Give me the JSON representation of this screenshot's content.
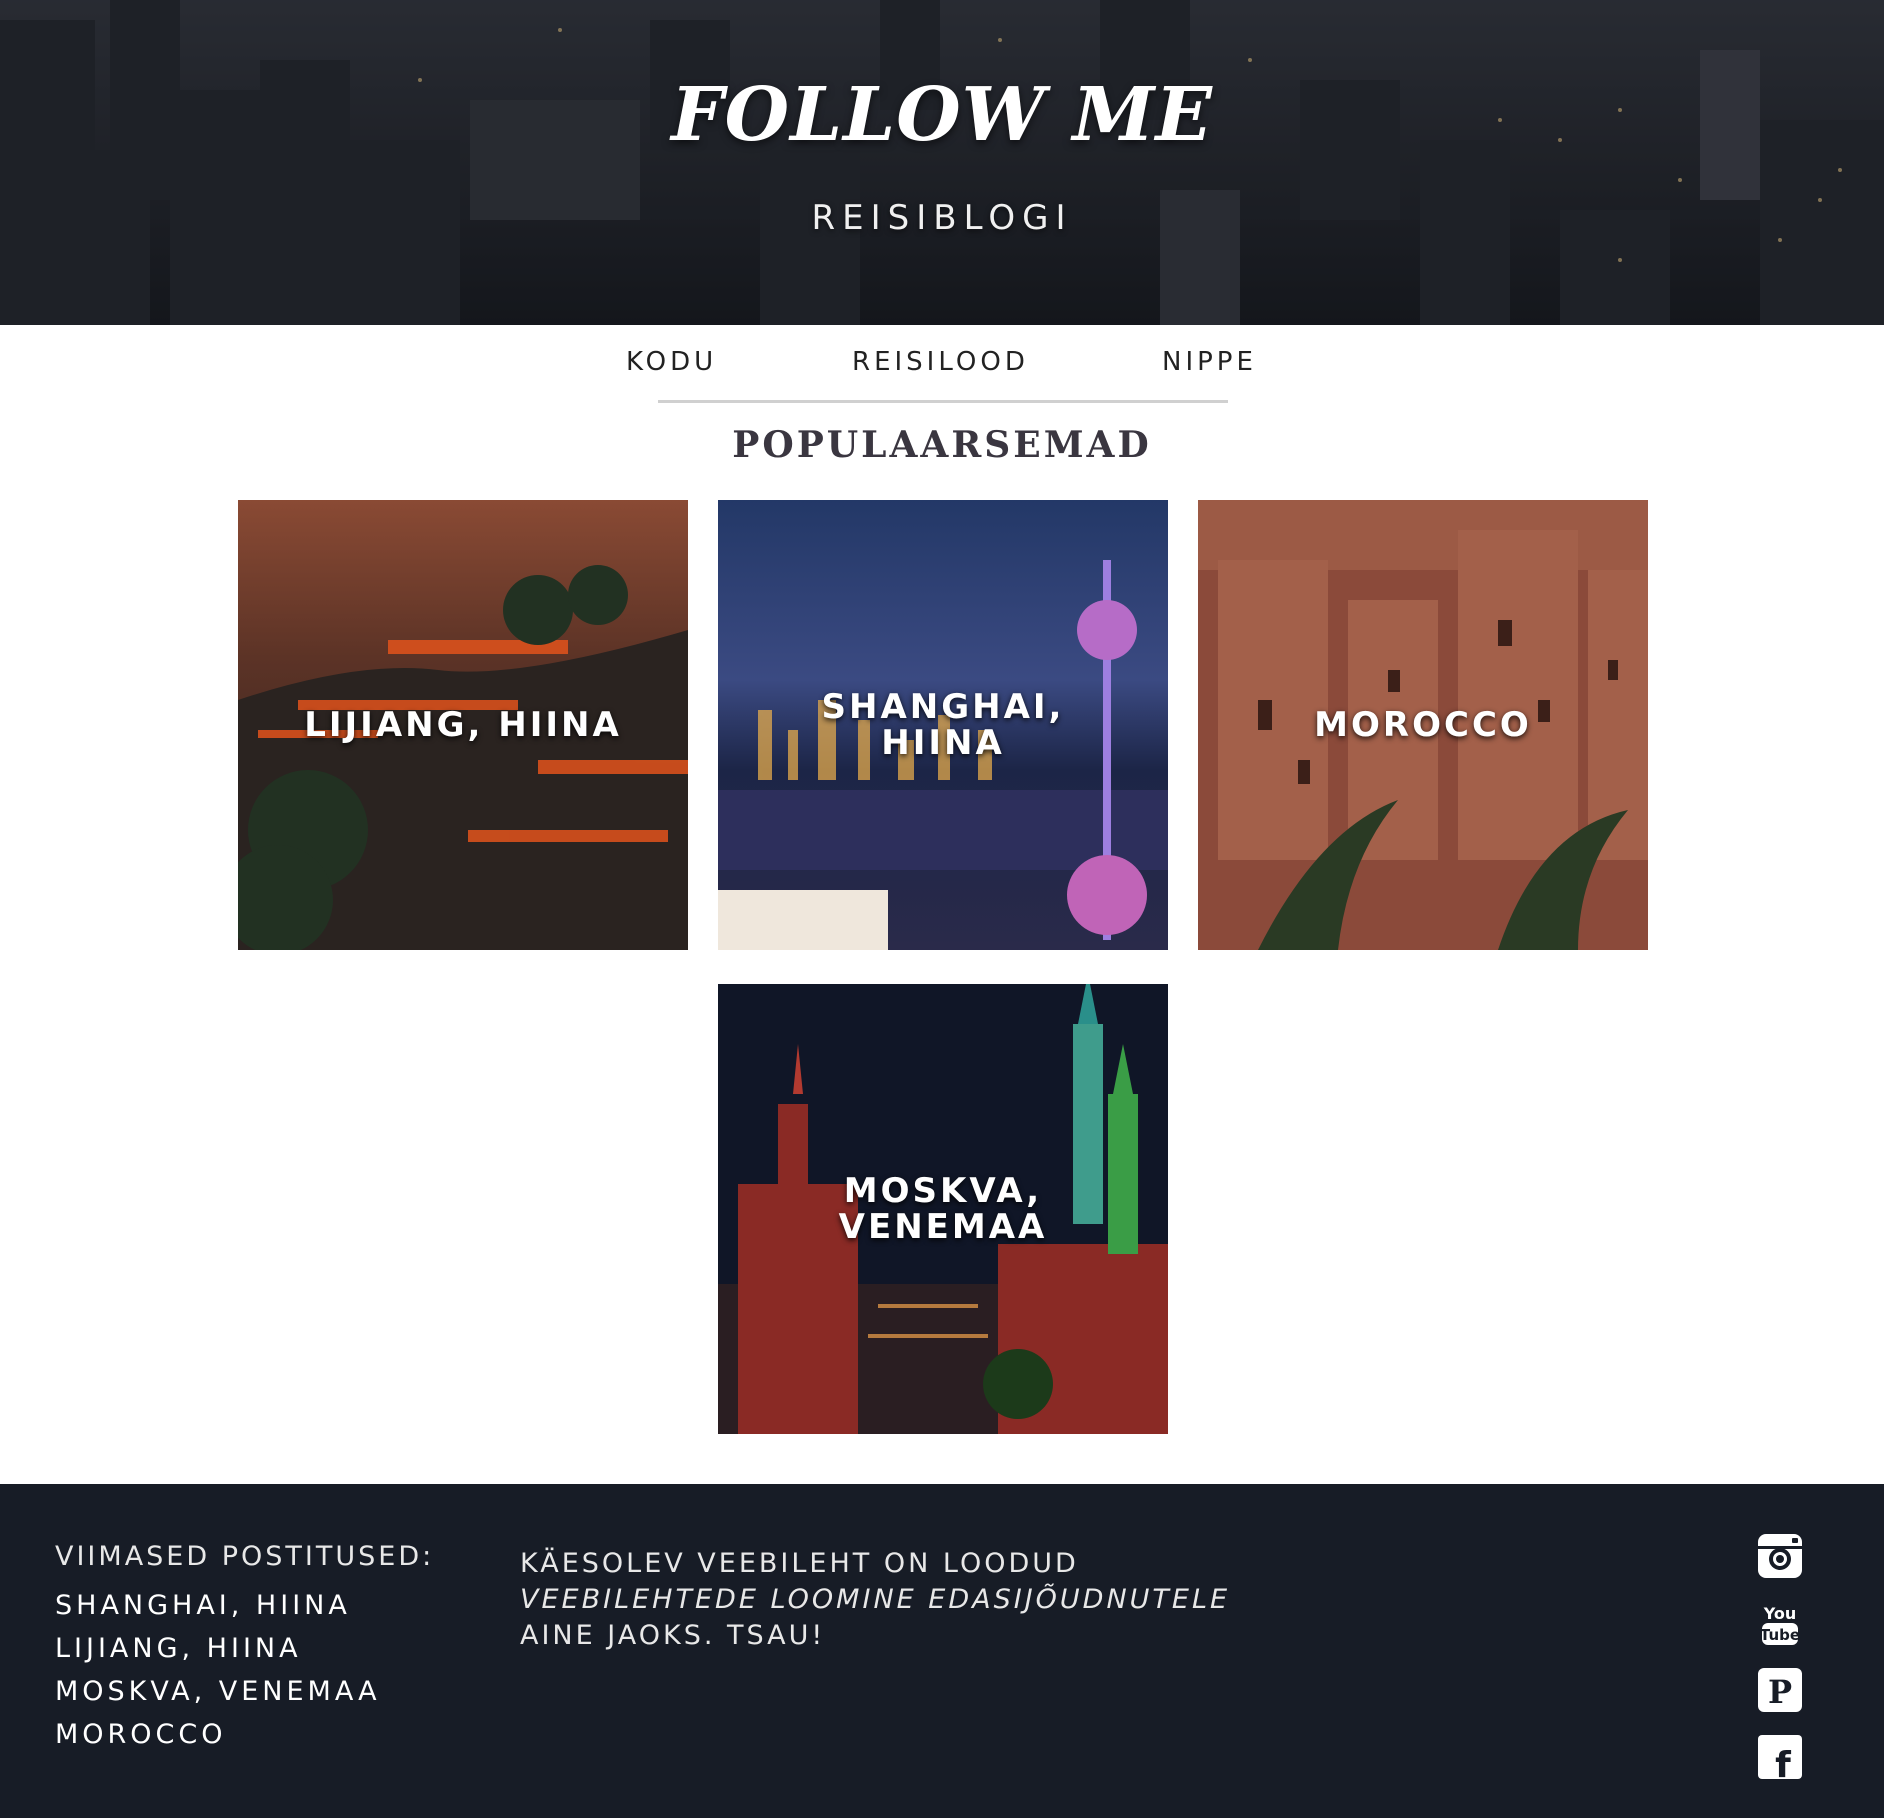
{
  "header": {
    "title": "FOLLOW ME",
    "subtitle": "REISIBLOGI"
  },
  "nav": {
    "items": [
      {
        "label": "KODU"
      },
      {
        "label": "REISILOOD"
      },
      {
        "label": "NIPPE"
      }
    ]
  },
  "popular": {
    "title": "POPULAARSEMAD",
    "cards": [
      {
        "label": "LIJIANG, HIINA"
      },
      {
        "label": "SHANGHAI, HIINA"
      },
      {
        "label": "MOROCCO"
      },
      {
        "label": "MOSKVA, VENEMAA"
      }
    ]
  },
  "footer": {
    "recent_heading": "VIIMASED POSTITUSED:",
    "recent_posts": [
      "SHANGHAI, HIINA",
      "LIJIANG, HIINA",
      "MOSKVA, VENEMAA",
      "MOROCCO"
    ],
    "about_line1": "KÄESOLEV VEEBILEHT ON LOODUD",
    "about_course": "VEEBILEHTEDE LOOMINE EDASIJÕUDNUTELE",
    "about_line3": "AINE JAOKS. TSAU!",
    "social_icons": [
      "instagram-icon",
      "youtube-icon",
      "pinterest-icon",
      "facebook-icon"
    ]
  },
  "colors": {
    "footer_bg": "#171c26",
    "nav_line": "#d0d0d0",
    "section_title": "#3a3640"
  }
}
